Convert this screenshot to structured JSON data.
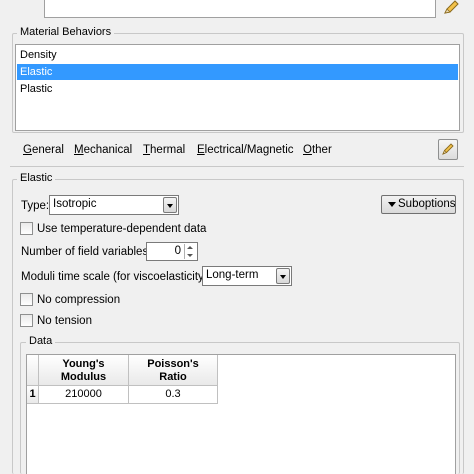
{
  "behaviors": {
    "group_label": "Material Behaviors",
    "items": [
      {
        "label": "Density",
        "selected": false
      },
      {
        "label": "Elastic",
        "selected": true
      },
      {
        "label": "Plastic",
        "selected": false
      }
    ]
  },
  "menu": {
    "items": [
      {
        "first": "G",
        "rest": "eneral"
      },
      {
        "first": "M",
        "rest": "echanical"
      },
      {
        "first": "T",
        "rest": "hermal"
      },
      {
        "first": "E",
        "rest": "lectrical/Magnetic"
      },
      {
        "first": "O",
        "rest": "ther"
      }
    ]
  },
  "elastic": {
    "group_label": "Elastic",
    "type_label": "Type:",
    "type_value": "Isotropic",
    "suboptions_label": "Suboptions",
    "temp_dependent_label": "Use temperature-dependent data",
    "field_vars_label": "Number of field variables:",
    "field_vars_value": "0",
    "moduli_label": "Moduli time scale (for viscoelasticity):",
    "moduli_value": "Long-term",
    "no_compression_label": "No compression",
    "no_tension_label": "No tension"
  },
  "data": {
    "group_label": "Data",
    "columns": [
      {
        "line1": "Young's",
        "line2": "Modulus"
      },
      {
        "line1": "Poisson's",
        "line2": "Ratio"
      }
    ],
    "rows": [
      {
        "index": "1",
        "cells": [
          "210000",
          "0.3"
        ]
      }
    ]
  },
  "colors": {
    "selection": "#3399ff",
    "background": "#f0f0f0"
  }
}
